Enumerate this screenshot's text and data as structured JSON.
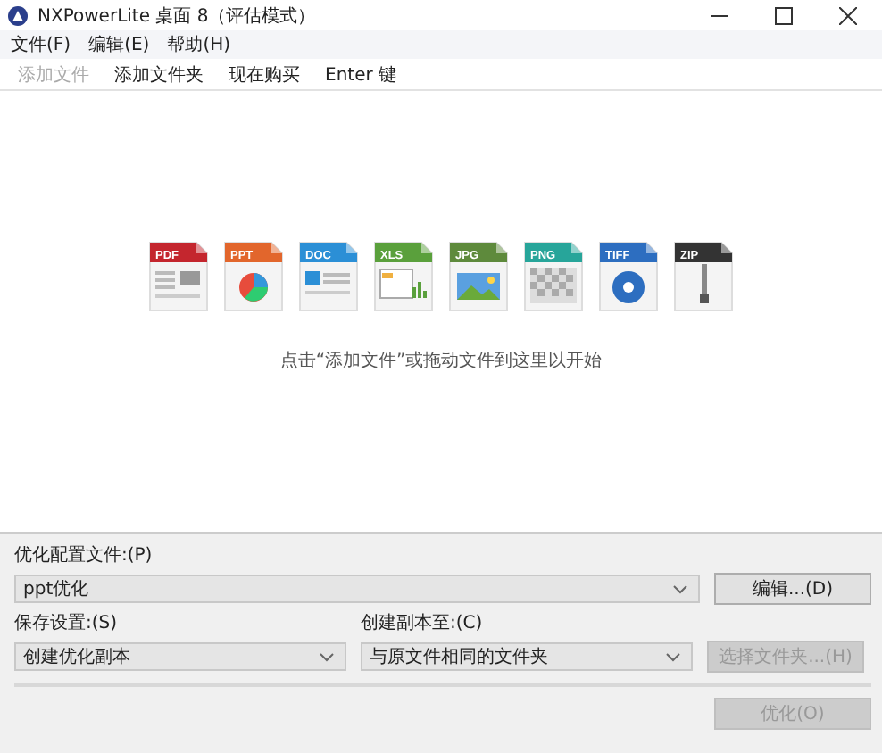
{
  "window": {
    "title": "NXPowerLite 桌面 8（评估模式）"
  },
  "menu": [
    {
      "label": "文件(F)"
    },
    {
      "label": "编辑(E)"
    },
    {
      "label": "帮助(H)"
    }
  ],
  "toolbar": [
    {
      "label": "添加文件",
      "disabled": true
    },
    {
      "label": "添加文件夹",
      "disabled": false
    },
    {
      "label": "现在购买",
      "disabled": false
    },
    {
      "label": "Enter 键",
      "disabled": false
    }
  ],
  "file_types": [
    {
      "label": "PDF",
      "kind": "pdf",
      "color": "#c4262e"
    },
    {
      "label": "PPT",
      "kind": "ppt",
      "color": "#e2662c"
    },
    {
      "label": "DOC",
      "kind": "doc",
      "color": "#2b8fd6"
    },
    {
      "label": "XLS",
      "kind": "xls",
      "color": "#5aa03c"
    },
    {
      "label": "JPG",
      "kind": "jpg",
      "color": "#5e8a3c"
    },
    {
      "label": "PNG",
      "kind": "png",
      "color": "#27a59a"
    },
    {
      "label": "TIFF",
      "kind": "tiff",
      "color": "#2d6ec0"
    },
    {
      "label": "ZIP",
      "kind": "zip",
      "color": "#333333"
    }
  ],
  "hint": "点击“添加文件”或拖动文件到这里以开始",
  "profile": {
    "label": "优化配置文件:(P)",
    "value": "ppt优化",
    "edit_button": "编辑...(D)"
  },
  "save": {
    "label": "保存设置:(S)",
    "value": "创建优化副本"
  },
  "copy_to": {
    "label": "创建副本至:(C)",
    "value": "与原文件相同的文件夹",
    "button": "选择文件夹...(H)",
    "button_disabled": true
  },
  "optimize_button": {
    "label": "优化(O)",
    "disabled": true
  }
}
